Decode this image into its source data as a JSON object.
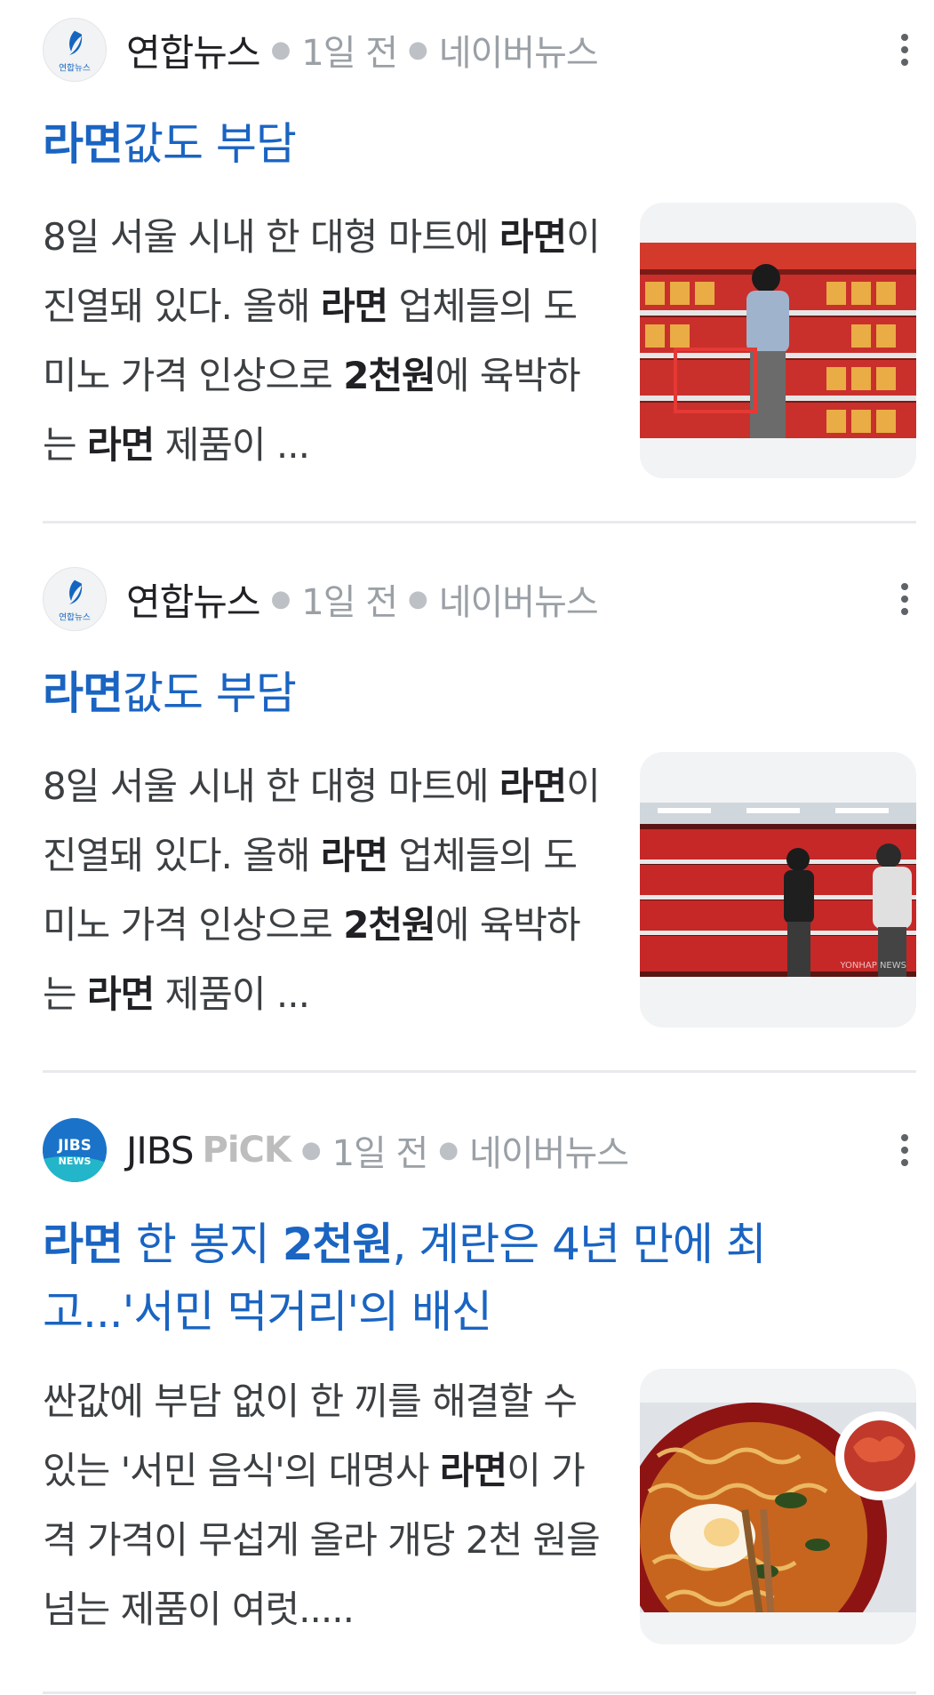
{
  "articles": [
    {
      "source": "연합뉴스",
      "logo_text": "연합뉴스",
      "time": "1일 전",
      "platform": "네이버뉴스",
      "title_bold": "라면",
      "title_rest": "값도 부담",
      "snippet": {
        "p1": "8일 서울 시내 한 대형 마트에 ",
        "b1": "라면",
        "p2": "이 진열돼 있다. 올해 ",
        "b2": "라면",
        "p3": " 업체들의 도미노 가격 인상으로 ",
        "b3": "2천원",
        "p4": "에 육박하는 ",
        "b4": "라면",
        "p5": " 제품이 ..."
      },
      "image": "supermarket-ramen-shelf-shopper"
    },
    {
      "source": "연합뉴스",
      "logo_text": "연합뉴스",
      "time": "1일 전",
      "platform": "네이버뉴스",
      "title_bold": "라면",
      "title_rest": "값도 부담",
      "snippet": {
        "p1": "8일 서울 시내 한 대형 마트에 ",
        "b1": "라면",
        "p2": "이 진열돼 있다. 올해 ",
        "b2": "라면",
        "p3": " 업체들의 도미노 가격 인상으로 ",
        "b3": "2천원",
        "p4": "에 육박하는 ",
        "b4": "라면",
        "p5": " 제품이 ..."
      },
      "image": "supermarket-ramen-aisle-shoppers",
      "image_watermark": "YONHAP NEWS"
    },
    {
      "source": "JIBS",
      "source_tag": "PiCK",
      "logo_text_top": "JIBS",
      "logo_text_bottom": "NEWS",
      "time": "1일 전",
      "platform": "네이버뉴스",
      "title_b1": "라면",
      "title_p1": " 한 봉지 ",
      "title_b2": "2천원",
      "title_p2": ", 계란은 4년 만에 최고...'서민 먹거리'의 배신",
      "snippet": {
        "p1": "싼값에 부담 없이 한 끼를 해결할 수 있는 '서민 음식'의 대명사 ",
        "b1": "라면",
        "p2": "이 가격 가격이 무섭게 올라 개당 2천 원을 넘는 제품이 여럿....."
      },
      "image": "bowl-of-ramen-with-kimchi"
    }
  ],
  "colors": {
    "title_blue": "#1a64c2",
    "meta_gray": "#9aa0a6",
    "divider": "#e8eaed",
    "ramen_red": "#c62828"
  }
}
